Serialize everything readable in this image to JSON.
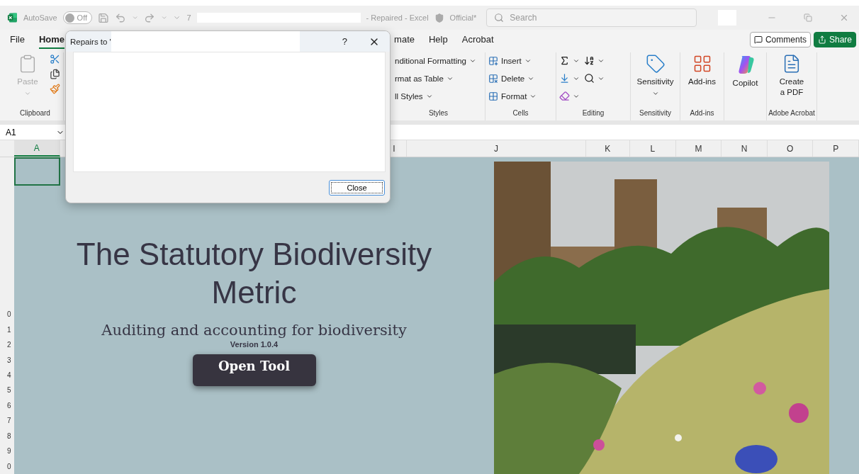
{
  "title_bar": {
    "autosave_label": "AutoSave",
    "autosave": {
      "on": false,
      "label": "Off"
    },
    "file_name_start": "7",
    "title_suffix": "- Repaired - Excel",
    "sensitivity_label": "Official*",
    "search": {
      "placeholder": "Search"
    }
  },
  "ribbon_tabs": [
    {
      "label": "File",
      "selected": false
    },
    {
      "label": "Home",
      "selected": true
    },
    {
      "label": "mate",
      "selected": false
    },
    {
      "label": "Help",
      "selected": false
    },
    {
      "label": "Acrobat",
      "selected": false
    }
  ],
  "comments_button": "Comments",
  "share_button": "Share",
  "ribbon_groups": [
    {
      "kind": "clipboard",
      "label": "Clipboard",
      "items": [
        {
          "label": "Paste",
          "disabled": true
        }
      ]
    },
    {
      "kind": "styles",
      "label": "Styles",
      "items": [
        {
          "label": "nditional Formatting"
        },
        {
          "label": "rmat as Table"
        },
        {
          "label": "ll Styles"
        }
      ]
    },
    {
      "kind": "cells",
      "label": "Cells",
      "items": [
        {
          "label": "Insert"
        },
        {
          "label": "Delete"
        },
        {
          "label": "Format"
        }
      ]
    },
    {
      "kind": "editing",
      "label": "Editing"
    },
    {
      "kind": "sensitivity",
      "label": "Sensitivity",
      "items": [
        {
          "label": "Sensitivity"
        }
      ]
    },
    {
      "kind": "addins",
      "label": "Add-ins",
      "items": [
        {
          "label": "Add-ins"
        }
      ]
    },
    {
      "kind": "copilot",
      "items": [
        {
          "label": "Copilot"
        }
      ]
    },
    {
      "kind": "acrobat",
      "label": "Adobe Acrobat",
      "items": [
        {
          "label": "Create a PDF"
        }
      ]
    }
  ],
  "name_box": "A1",
  "columns": [
    {
      "label": "A",
      "selected": true
    },
    {
      "label": "I",
      "selected": false
    },
    {
      "label": "J",
      "selected": false
    },
    {
      "label": "K",
      "selected": false
    },
    {
      "label": "L",
      "selected": false
    },
    {
      "label": "M",
      "selected": false
    },
    {
      "label": "N",
      "selected": false
    },
    {
      "label": "O",
      "selected": false
    },
    {
      "label": "P",
      "selected": false
    }
  ],
  "row_numbers": [
    "0",
    "1",
    "2",
    "3",
    "4",
    "5",
    "6",
    "7",
    "8",
    "9",
    "0"
  ],
  "sheet": {
    "title": "The Statutory Biodiversity Metric",
    "subtitle": "Auditing and accounting for biodiversity",
    "version": "Version 1.0.4",
    "button": "Open Tool"
  },
  "dialog": {
    "title": "Repairs to '",
    "help": "?",
    "close_button": "Close"
  }
}
